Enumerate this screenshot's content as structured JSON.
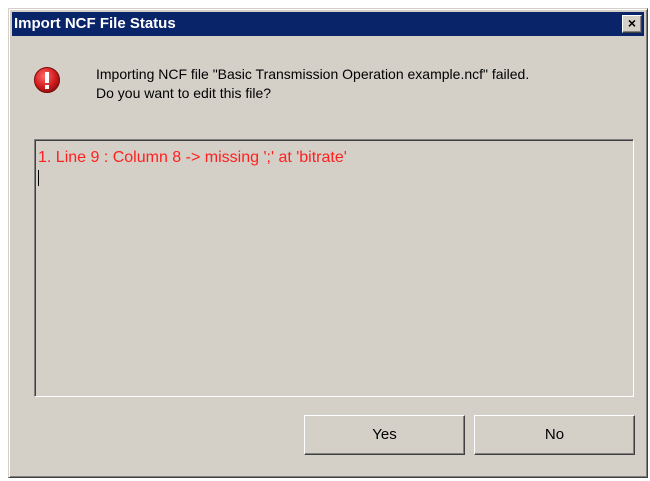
{
  "window": {
    "title": "Import NCF File Status",
    "close_label": "×"
  },
  "message": {
    "line1": "Importing NCF file \"Basic Transmission Operation example.ncf\" failed.",
    "line2": "Do you want to edit this file?",
    "icon": "error-icon"
  },
  "log": {
    "lines": [
      "1. Line 9 : Column 8 -> missing ';' at 'bitrate'"
    ],
    "text_color": "#ff2020"
  },
  "buttons": {
    "yes_label": "Yes",
    "no_label": "No"
  },
  "colors": {
    "titlebar": "#0a246a",
    "dialog_face": "#d4d0c8",
    "error_red": "#d42020"
  }
}
